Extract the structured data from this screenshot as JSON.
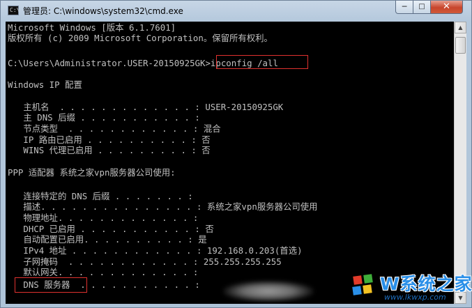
{
  "window": {
    "title": "管理员: C:\\windows\\system32\\cmd.exe",
    "icon": "cmd-prompt-icon",
    "controls": {
      "minimize": "─",
      "maximize": "□",
      "close": "✕"
    }
  },
  "console": {
    "lines": [
      "Microsoft Windows [版本 6.1.7601]",
      "版权所有 (c) 2009 Microsoft Corporation。保留所有权利。",
      "",
      "C:\\Users\\Administrator.USER-20150925GK>ipconfig /all",
      "",
      "Windows IP 配置",
      "",
      "   主机名  . . . . . . . . . . . . . : USER-20150925GK",
      "   主 DNS 后缀 . . . . . . . . . . . :",
      "   节点类型  . . . . . . . . . . . . : 混合",
      "   IP 路由已启用 . . . . . . . . . . : 否",
      "   WINS 代理已启用 . . . . . . . . . : 否",
      "",
      "PPP 适配器 系统之家vpn服务器公司使用:",
      "",
      "   连接特定的 DNS 后缀 . . . . . . . :",
      "   描述. . . . . . . . . . . . . . . : 系统之家vpn服务器公司使用",
      "   物理地址. . . . . . . . . . . . . :",
      "   DHCP 已启用 . . . . . . . . . . . : 否",
      "   自动配置已启用. . . . . . . . . . : 是",
      "   IPv4 地址 . . . . . . . . . . . . : 192.168.0.203(首选)",
      "   子网掩码  . . . . . . . . . . . . : 255.255.255.255",
      "   默认网关. . . . . . . . . . . . . :",
      "   DNS 服务器  . . . . . . . . . . . :"
    ]
  },
  "scrollbar": {
    "up": "▲",
    "down": "▼"
  },
  "watermark": {
    "brand": "W系统之家",
    "url": "www.lkwxp.com"
  },
  "colors": {
    "console_bg": "#000000",
    "console_fg": "#c0c0c0",
    "highlight": "#e0312f",
    "watermark": "#2a8fe8"
  }
}
